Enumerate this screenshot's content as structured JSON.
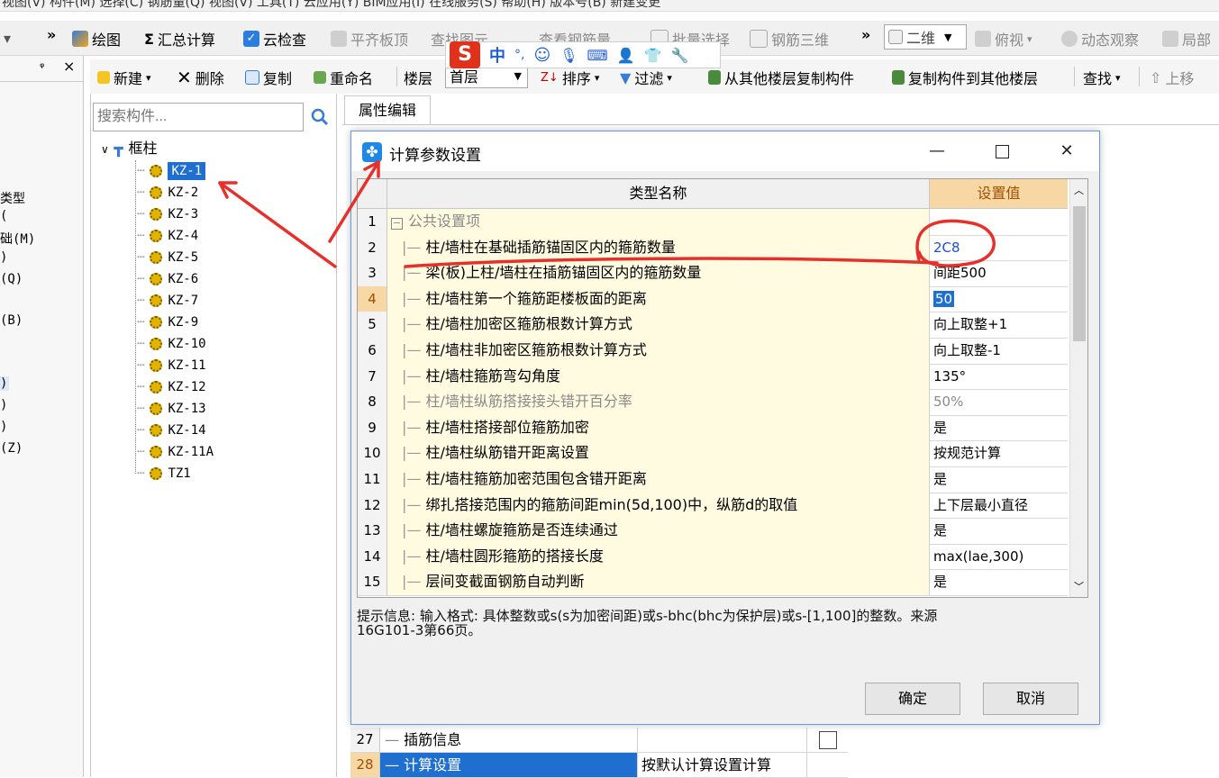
{
  "menubar": {
    "text": "视图(V) 构件(M) 选择(C) 钢筋量(Q) 视图(V) 工具(T) 云应用(Y) BIM应用(I) 在线服务(S) 帮助(H) 版本号(B) 新建变更 "
  },
  "toolbar1": {
    "draw": "绘图",
    "sum": "汇总计算",
    "cloud_check": "云检查",
    "flat_board": "平齐板顶",
    "find_elem": "查找图元",
    "view_steel": "查看钢筋量",
    "batch_select": "批量选择",
    "steel_3d": "钢筋三维",
    "view_mode": "二维",
    "top_view": "俯视",
    "dyn_observe": "动态观察",
    "local": "局部"
  },
  "toolbar2": {
    "new": "新建",
    "delete": "删除",
    "copy": "复制",
    "rename": "重命名",
    "floor_label": "楼层",
    "floor_value": "首层",
    "sort": "排序",
    "filter": "过滤",
    "copy_from": "从其他楼层复制构件",
    "copy_to": "复制构件到其他楼层",
    "find": "查找",
    "up": "上移"
  },
  "left_panel": {
    "items": [
      "类型",
      "(",
      "础(M)",
      ")",
      "(Q)",
      "(B)",
      ")",
      ")",
      ")",
      "(Z)"
    ]
  },
  "search": {
    "placeholder": "搜索构件..."
  },
  "tree": {
    "root": "框柱",
    "items": [
      "KZ-1",
      "KZ-2",
      "KZ-3",
      "KZ-4",
      "KZ-5",
      "KZ-6",
      "KZ-7",
      "KZ-9",
      "KZ-10",
      "KZ-11",
      "KZ-12",
      "KZ-13",
      "KZ-14",
      "KZ-11A",
      "TZ1"
    ]
  },
  "prop_tab": "属性编辑",
  "dialog": {
    "title": "计算参数设置",
    "col_name": "类型名称",
    "col_value": "设置值",
    "rows": [
      {
        "n": "1",
        "name": "公共设置项",
        "value": ""
      },
      {
        "n": "2",
        "name": "柱/墙柱在基础插筋锚固区内的箍筋数量",
        "value": "2C8"
      },
      {
        "n": "3",
        "name": "梁(板)上柱/墙柱在插筋锚固区内的箍筋数量",
        "value": "间距500"
      },
      {
        "n": "4",
        "name": "柱/墙柱第一个箍筋距楼板面的距离",
        "value": "50"
      },
      {
        "n": "5",
        "name": "柱/墙柱加密区箍筋根数计算方式",
        "value": "向上取整+1"
      },
      {
        "n": "6",
        "name": "柱/墙柱非加密区箍筋根数计算方式",
        "value": "向上取整-1"
      },
      {
        "n": "7",
        "name": "柱/墙柱箍筋弯勾角度",
        "value": "135°"
      },
      {
        "n": "8",
        "name": "柱/墙柱纵筋搭接接头错开百分率",
        "value": "50%"
      },
      {
        "n": "9",
        "name": "柱/墙柱搭接部位箍筋加密",
        "value": "是"
      },
      {
        "n": "10",
        "name": "柱/墙柱纵筋错开距离设置",
        "value": "按规范计算"
      },
      {
        "n": "11",
        "name": "柱/墙柱箍筋加密范围包含错开距离",
        "value": "是"
      },
      {
        "n": "12",
        "name": "绑扎搭接范围内的箍筋间距min(5d,100)中，纵筋d的取值",
        "value": "上下层最小直径"
      },
      {
        "n": "13",
        "name": "柱/墙柱螺旋箍筋是否连续通过",
        "value": "是"
      },
      {
        "n": "14",
        "name": "柱/墙柱圆形箍筋的搭接长度",
        "value": "max(lae,300)"
      },
      {
        "n": "15",
        "name": "层间变截面钢筋自动判断",
        "value": "是"
      }
    ],
    "hint_line1": "提示信息: 输入格式: 具体整数或s(s为加密间距)或s-bhc(bhc为保护层)或s-[1,100]的整数。来源",
    "hint_line2": "16G101-3第66页。",
    "ok": "确定",
    "cancel": "取消"
  },
  "bottom_rows": [
    {
      "n": "27",
      "name": "插筋信息",
      "value": ""
    },
    {
      "n": "28",
      "name": "计算设置",
      "value": "按默认计算设置计算"
    }
  ],
  "ime": {
    "logo": "S",
    "lang": "中",
    "punct": "°,"
  },
  "colors": {
    "annotation_red": "#e8302a",
    "selection_blue": "#1f6fd1",
    "header_orange": "#f7d7a3",
    "row_yellow": "#fffbe0"
  }
}
